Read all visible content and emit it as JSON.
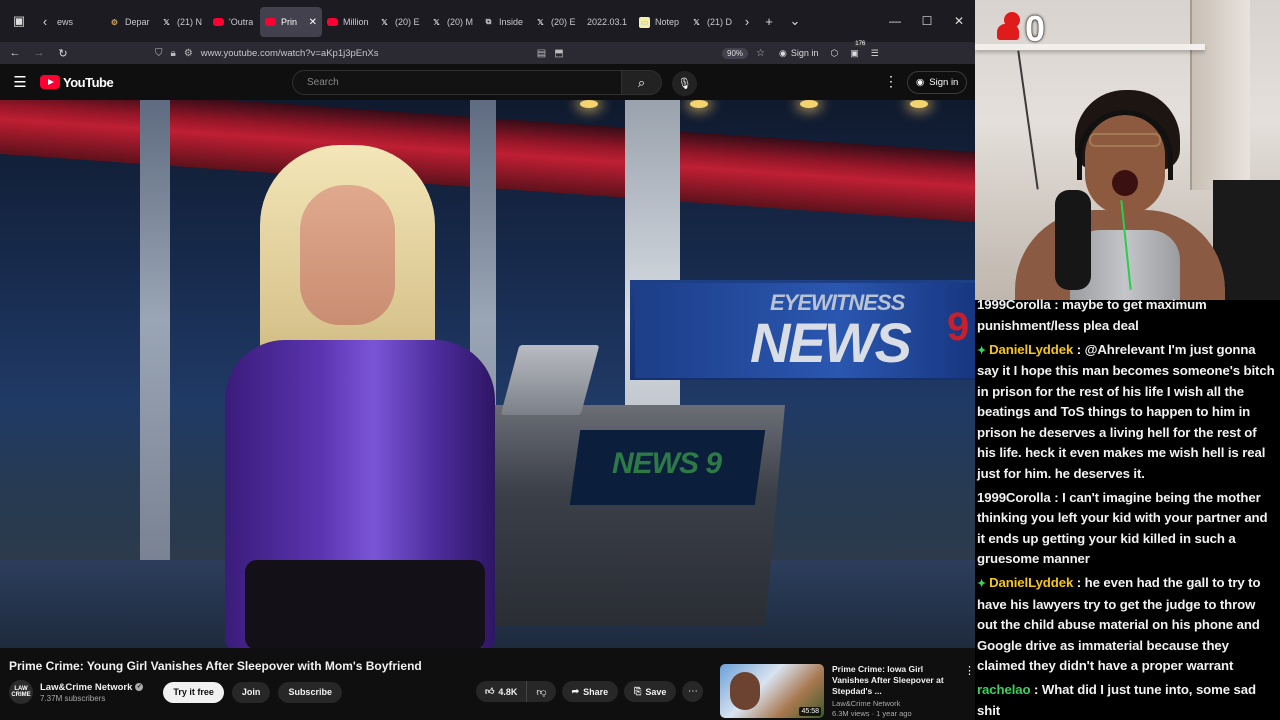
{
  "browser": {
    "tabs": [
      {
        "label": "ews",
        "icon": "none"
      },
      {
        "label": "Depar",
        "icon": "gear-icon"
      },
      {
        "label": "(21) N",
        "icon": "x-icon"
      },
      {
        "label": "'Outra",
        "icon": "youtube-icon"
      },
      {
        "label": "Prin",
        "icon": "youtube-icon",
        "active": true
      },
      {
        "label": "Million",
        "icon": "youtube-icon"
      },
      {
        "label": "(20) E",
        "icon": "x-icon"
      },
      {
        "label": "(20) M",
        "icon": "x-icon"
      },
      {
        "label": "Inside",
        "icon": "bookmark-icon"
      },
      {
        "label": "(20) E",
        "icon": "x-icon"
      },
      {
        "label": "2022.03.1",
        "icon": "none"
      },
      {
        "label": "Notep",
        "icon": "note-icon"
      },
      {
        "label": "(21) D",
        "icon": "x-icon"
      }
    ],
    "url": "www.youtube.com/watch?v=aKp1j3pEnXs",
    "zoom": "90%",
    "signin_label": "Sign in",
    "notif_count": "176"
  },
  "youtube": {
    "logo_text": "YouTube",
    "search_placeholder": "Search",
    "signin_label": "Sign in",
    "video": {
      "title": "Prime Crime: Young Girl Vanishes After Sleepover with Mom's Boyfriend",
      "scene_text": {
        "wall_top": "EYEWITNESS",
        "wall_main": "NEWS",
        "wall_num": "9",
        "desk": "NEWS 9"
      },
      "channel": "Law&Crime Network",
      "channel_avatar": "LAW CRIME",
      "subscribers": "7.37M subscribers",
      "try_free": "Try it free",
      "join": "Join",
      "subscribe": "Subscribe",
      "likes": "4.8K",
      "share": "Share",
      "save": "Save"
    },
    "recommendation": {
      "title": "Prime Crime: Iowa Girl Vanishes After Sleepover at Stepdad's ...",
      "channel": "Law&Crime Network",
      "meta": "6.3M views · 1 year ago",
      "duration": "45:58"
    }
  },
  "stream": {
    "overlay_count": "0",
    "chat": [
      {
        "user": "1999Corolla",
        "user_color": "#f2f2f2",
        "badge": false,
        "text": "maybe to get maximum punishment/less plea deal"
      },
      {
        "user": "DanielLyddek",
        "user_color": "#f5c518",
        "badge": true,
        "text": "@Ahrelevant I'm just gonna say it I hope this man becomes someone's bitch in prison for the rest of his life I wish all the beatings and ToS things to happen to him in prison he deserves a living hell for the rest of his life. heck it even makes me wish hell is real just for him. he deserves it."
      },
      {
        "user": "1999Corolla",
        "user_color": "#f2f2f2",
        "badge": false,
        "text": "I can't imagine being the mother thinking you left your kid with your partner and it ends up getting your kid killed in such a gruesome manner"
      },
      {
        "user": "DanielLyddek",
        "user_color": "#f5c518",
        "badge": true,
        "text": "he even had the gall to try to have his lawyers try to get the judge to throw out the child abuse material on his phone and Google drive as immaterial because they claimed they didn't have a proper warrant"
      },
      {
        "user": "rachelao",
        "user_color": "#3bd15a",
        "badge": false,
        "text": "What did I just tune into, some sad shit"
      }
    ]
  }
}
